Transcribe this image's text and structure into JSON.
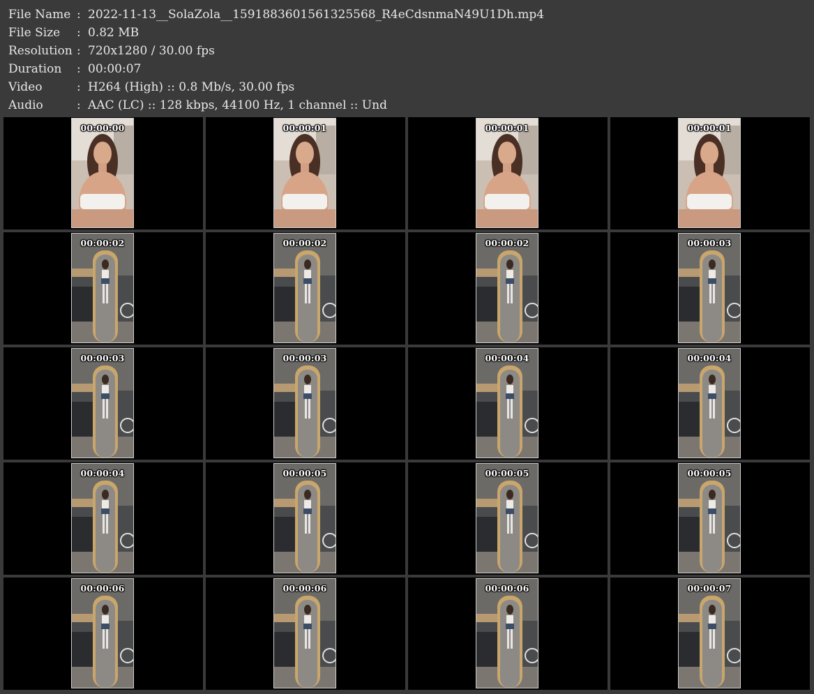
{
  "info": [
    {
      "label": "File Name",
      "value": "2022-11-13__SolaZola__1591883601561325568_R4eCdsnmaN49U1Dh.mp4"
    },
    {
      "label": "File Size",
      "value": "0.82 MB"
    },
    {
      "label": "Resolution",
      "value": "720x1280 / 30.00 fps"
    },
    {
      "label": "Duration",
      "value": "00:00:07"
    },
    {
      "label": "Video",
      "value": "H264 (High) :: 0.8 Mb/s, 30.00 fps"
    },
    {
      "label": "Audio",
      "value": "AAC (LC) :: 128 kbps, 44100 Hz, 1 channel :: Und"
    }
  ],
  "separator": ":",
  "thumbnails": [
    {
      "time": "00:00:00",
      "scene": "selfie"
    },
    {
      "time": "00:00:01",
      "scene": "selfie"
    },
    {
      "time": "00:00:01",
      "scene": "selfie"
    },
    {
      "time": "00:00:01",
      "scene": "selfie"
    },
    {
      "time": "00:00:02",
      "scene": "mirror"
    },
    {
      "time": "00:00:02",
      "scene": "mirror"
    },
    {
      "time": "00:00:02",
      "scene": "mirror"
    },
    {
      "time": "00:00:03",
      "scene": "mirror"
    },
    {
      "time": "00:00:03",
      "scene": "mirror"
    },
    {
      "time": "00:00:03",
      "scene": "mirror"
    },
    {
      "time": "00:00:04",
      "scene": "mirror"
    },
    {
      "time": "00:00:04",
      "scene": "mirror"
    },
    {
      "time": "00:00:04",
      "scene": "mirror"
    },
    {
      "time": "00:00:05",
      "scene": "mirror"
    },
    {
      "time": "00:00:05",
      "scene": "mirror"
    },
    {
      "time": "00:00:05",
      "scene": "mirror"
    },
    {
      "time": "00:00:06",
      "scene": "mirror"
    },
    {
      "time": "00:00:06",
      "scene": "mirror"
    },
    {
      "time": "00:00:06",
      "scene": "mirror"
    },
    {
      "time": "00:00:07",
      "scene": "mirror"
    }
  ],
  "colors": {
    "background": "#3a3a3a",
    "cell": "#000000",
    "text": "#e8e8e8"
  }
}
